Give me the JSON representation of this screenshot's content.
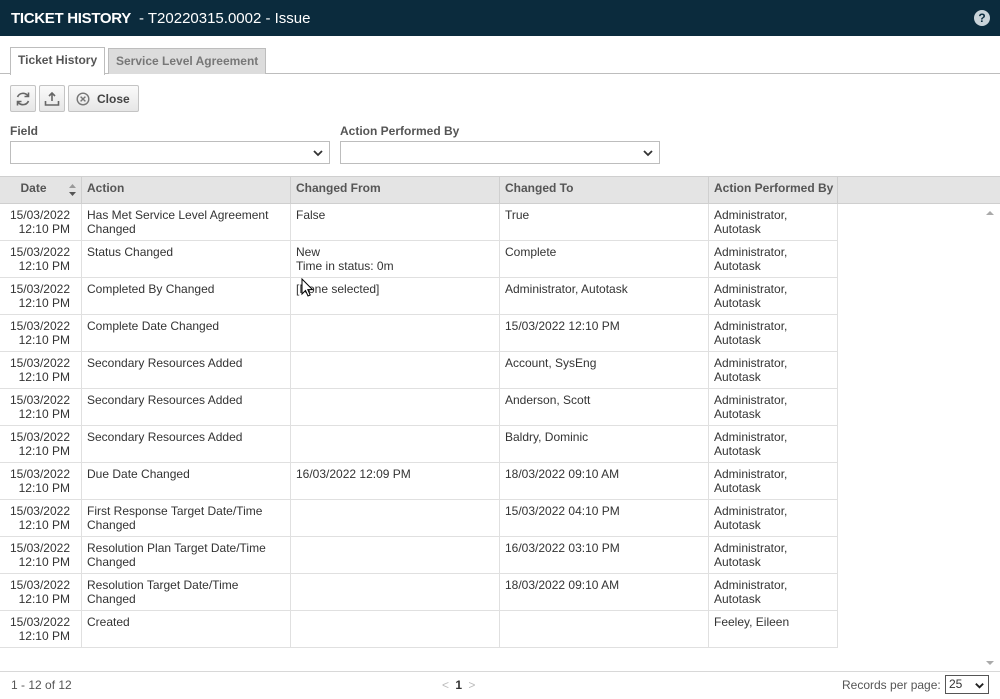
{
  "header": {
    "title": "TICKET HISTORY",
    "subtitle": "- T20220315.0002 - Issue",
    "help_icon": "help-icon"
  },
  "tabs": [
    {
      "label": "Ticket History",
      "active": true
    },
    {
      "label": "Service Level Agreement",
      "active": false
    }
  ],
  "toolbar": {
    "refresh_icon": "refresh-icon",
    "export_icon": "export-icon",
    "close_label": "Close"
  },
  "filters": {
    "field_label": "Field",
    "field_value": "",
    "performed_by_label": "Action Performed By",
    "performed_by_value": ""
  },
  "columns": {
    "date": "Date",
    "action": "Action",
    "from": "Changed From",
    "to": "Changed To",
    "by": "Action Performed By"
  },
  "rows": [
    {
      "date": "15/03/2022",
      "time": "12:10 PM",
      "action": "Has Met Service Level Agreement",
      "action2": "Changed",
      "from": "False",
      "from2": "",
      "to": "True",
      "by": "Administrator,",
      "by2": "Autotask"
    },
    {
      "date": "15/03/2022",
      "time": "12:10 PM",
      "action": "Status Changed",
      "action2": "",
      "from": "New",
      "from2": "Time in status:  0m",
      "to": "Complete",
      "by": "Administrator,",
      "by2": "Autotask"
    },
    {
      "date": "15/03/2022",
      "time": "12:10 PM",
      "action": "Completed By Changed",
      "action2": "",
      "from": "[None selected]",
      "from2": "",
      "to": "Administrator, Autotask",
      "by": "Administrator,",
      "by2": "Autotask"
    },
    {
      "date": "15/03/2022",
      "time": "12:10 PM",
      "action": "Complete Date Changed",
      "action2": "",
      "from": "",
      "from2": "",
      "to": "15/03/2022 12:10 PM",
      "by": "Administrator,",
      "by2": "Autotask"
    },
    {
      "date": "15/03/2022",
      "time": "12:10 PM",
      "action": "Secondary Resources Added",
      "action2": "",
      "from": "",
      "from2": "",
      "to": "Account, SysEng",
      "by": "Administrator,",
      "by2": "Autotask"
    },
    {
      "date": "15/03/2022",
      "time": "12:10 PM",
      "action": "Secondary Resources Added",
      "action2": "",
      "from": "",
      "from2": "",
      "to": "Anderson, Scott",
      "by": "Administrator,",
      "by2": "Autotask"
    },
    {
      "date": "15/03/2022",
      "time": "12:10 PM",
      "action": "Secondary Resources Added",
      "action2": "",
      "from": "",
      "from2": "",
      "to": "Baldry, Dominic",
      "by": "Administrator,",
      "by2": "Autotask"
    },
    {
      "date": "15/03/2022",
      "time": "12:10 PM",
      "action": "Due Date Changed",
      "action2": "",
      "from": "16/03/2022 12:09 PM",
      "from2": "",
      "to": "18/03/2022 09:10 AM",
      "by": "Administrator,",
      "by2": "Autotask"
    },
    {
      "date": "15/03/2022",
      "time": "12:10 PM",
      "action": "First Response Target Date/Time",
      "action2": "Changed",
      "from": "",
      "from2": "",
      "to": "15/03/2022 04:10 PM",
      "by": "Administrator,",
      "by2": "Autotask"
    },
    {
      "date": "15/03/2022",
      "time": "12:10 PM",
      "action": "Resolution Plan Target Date/Time",
      "action2": "Changed",
      "from": "",
      "from2": "",
      "to": "16/03/2022 03:10 PM",
      "by": "Administrator,",
      "by2": "Autotask"
    },
    {
      "date": "15/03/2022",
      "time": "12:10 PM",
      "action": "Resolution Target Date/Time",
      "action2": "Changed",
      "from": "",
      "from2": "",
      "to": "18/03/2022 09:10 AM",
      "by": "Administrator,",
      "by2": "Autotask"
    },
    {
      "date": "15/03/2022",
      "time": "12:10 PM",
      "action": "Created",
      "action2": "",
      "from": "",
      "from2": "",
      "to": "",
      "by": "Feeley, Eileen",
      "by2": ""
    }
  ],
  "footer": {
    "count": "1 - 12 of 12",
    "prev": "<",
    "page": "1",
    "next": ">",
    "records_label": "Records per page:",
    "records_value": "25"
  }
}
